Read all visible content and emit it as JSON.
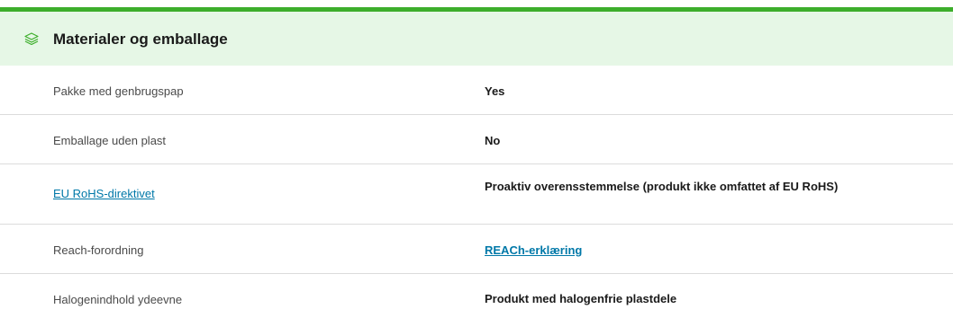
{
  "section": {
    "title": "Materialer og emballage",
    "icon": "layers-icon",
    "accent_color": "#3dae2b",
    "header_background": "#e6f7e6"
  },
  "rows": [
    {
      "label": "Pakke med genbrugspap",
      "value": "Yes"
    },
    {
      "label": "Emballage uden plast",
      "value": "No"
    },
    {
      "label": "EU RoHS-direktivet",
      "value": "Proaktiv overensstemmelse (produkt ikke omfattet af  EU RoHS)"
    },
    {
      "label": "Reach-forordning",
      "value": "REACh-erklæring"
    },
    {
      "label": "Halogenindhold ydeevne",
      "value": "Produkt med halogenfrie plastdele"
    }
  ],
  "link_color": "#0078a8"
}
